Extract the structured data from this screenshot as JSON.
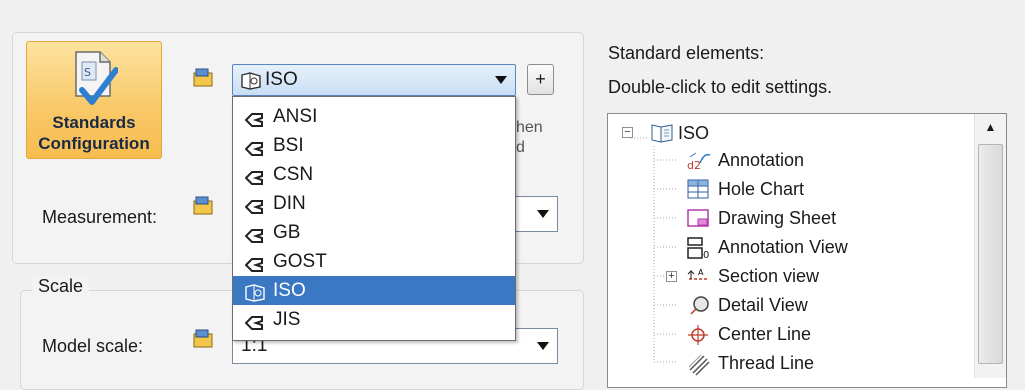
{
  "left_panel": {
    "standards_button": {
      "label_line1": "Standards",
      "label_line2": "Configuration"
    },
    "standard_combo": {
      "value": "ISO"
    },
    "plus_button": {
      "label": "+"
    },
    "partially_hidden_text": {
      "line1": "hen",
      "line2": "d"
    },
    "measurement": {
      "label": "Measurement:"
    },
    "scale_group": {
      "title": "Scale"
    },
    "model_scale": {
      "label": "Model scale:",
      "value": "1:1"
    },
    "dropdown": {
      "items": [
        {
          "label": "ANSI"
        },
        {
          "label": "BSI"
        },
        {
          "label": "CSN"
        },
        {
          "label": "DIN"
        },
        {
          "label": "GB"
        },
        {
          "label": "GOST"
        },
        {
          "label": "ISO",
          "selected": true
        },
        {
          "label": "JIS"
        }
      ]
    }
  },
  "right_panel": {
    "heading": "Standard elements:",
    "hint": "Double-click to edit settings.",
    "tree": {
      "root": {
        "label": "ISO",
        "expanded": true
      },
      "children": [
        {
          "label": "Annotation",
          "icon": "annotation-icon"
        },
        {
          "label": "Hole Chart",
          "icon": "hole-chart-icon"
        },
        {
          "label": "Drawing Sheet",
          "icon": "drawing-sheet-icon"
        },
        {
          "label": "Annotation View",
          "icon": "annotation-view-icon"
        },
        {
          "label": "Section view",
          "icon": "section-view-icon",
          "expandable": true
        },
        {
          "label": "Detail View",
          "icon": "detail-view-icon"
        },
        {
          "label": "Center Line",
          "icon": "center-line-icon"
        },
        {
          "label": "Thread Line",
          "icon": "thread-line-icon"
        }
      ]
    }
  },
  "colors": {
    "selection": "#3b78c4",
    "button_orange": "#f9c96a"
  }
}
